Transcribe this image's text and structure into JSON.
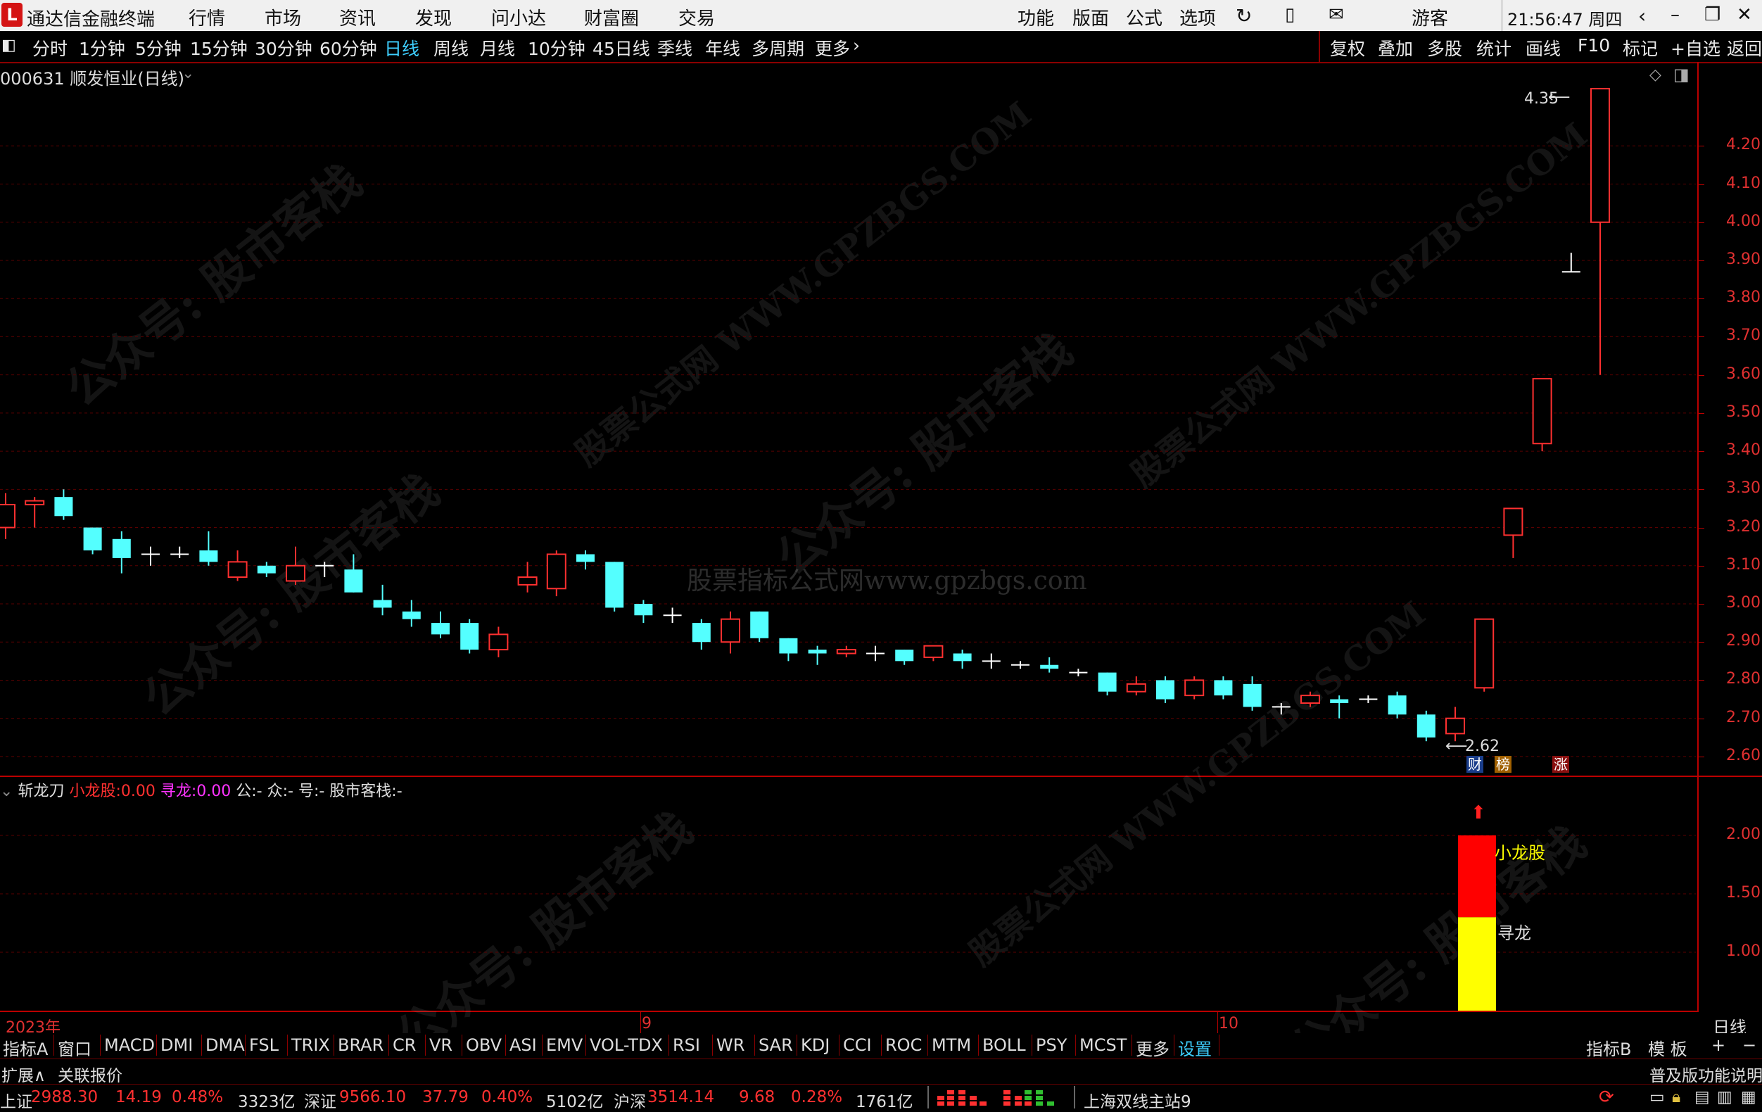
{
  "menubar": {
    "title": "通达信金融终端",
    "items": [
      "行情",
      "市场",
      "资讯",
      "发现",
      "问小达",
      "财富圈",
      "交易"
    ],
    "right_items": [
      "功能",
      "版面",
      "公式",
      "选项"
    ],
    "user": "游客",
    "clock": "21:56:47 周四"
  },
  "toolbar": {
    "periods": [
      "分时",
      "1分钟",
      "5分钟",
      "15分钟",
      "30分钟",
      "60分钟",
      "日线",
      "周线",
      "月线",
      "10分钟",
      "45日线",
      "季线",
      "年线",
      "多周期",
      "更多"
    ],
    "active": "日线",
    "right": [
      "复权",
      "叠加",
      "多股",
      "统计",
      "画线",
      "F10",
      "标记",
      "+自选",
      "返回"
    ]
  },
  "chart_header": "000631 顺发恒业(日线)",
  "indicator_header": {
    "name": "斩龙刀",
    "xiaolong_label": "小龙股:",
    "xiaolong_value": "0.00",
    "xunlong_label": "寻龙:",
    "xunlong_value": "0.00",
    "rest": "公:- 众:- 号:- 股市客栈:-"
  },
  "badges": [
    "财",
    "榜",
    "涨"
  ],
  "annotations": {
    "high": "4.35",
    "low": "2.62",
    "bar_top": "小龙股",
    "bar_low": "寻龙"
  },
  "x_axis": {
    "year": "2023年",
    "m9": "9",
    "m10": "10"
  },
  "watermarks": [
    "公众号: 股市客栈",
    "股票公式网  WWW.GPZBGS.COM",
    "股票指标公式网www.gpzbgs.com"
  ],
  "chart_data": {
    "type": "candlestick",
    "ylim": [
      2.55,
      4.42
    ],
    "yticks": [
      "4.20",
      "4.10",
      "4.00",
      "3.90",
      "3.80",
      "3.70",
      "3.60",
      "3.50",
      "3.40",
      "3.30",
      "3.20",
      "3.10",
      "3.00",
      "2.90",
      "2.80",
      "2.70",
      "2.60"
    ],
    "candles": [
      [
        3.2,
        3.26,
        3.17,
        3.29
      ],
      [
        3.26,
        3.27,
        3.2,
        3.28
      ],
      [
        3.28,
        3.23,
        3.22,
        3.3
      ],
      [
        3.2,
        3.14,
        3.13,
        3.2
      ],
      [
        3.17,
        3.12,
        3.08,
        3.19
      ],
      [
        3.13,
        3.13,
        3.1,
        3.15
      ],
      [
        3.13,
        3.13,
        3.12,
        3.15
      ],
      [
        3.14,
        3.11,
        3.1,
        3.19
      ],
      [
        3.07,
        3.11,
        3.06,
        3.14
      ],
      [
        3.1,
        3.08,
        3.07,
        3.11
      ],
      [
        3.06,
        3.1,
        3.05,
        3.15
      ],
      [
        3.1,
        3.1,
        3.07,
        3.11
      ],
      [
        3.09,
        3.03,
        3.03,
        3.13
      ],
      [
        3.01,
        2.99,
        2.97,
        3.05
      ],
      [
        2.98,
        2.96,
        2.94,
        3.01
      ],
      [
        2.95,
        2.92,
        2.91,
        2.98
      ],
      [
        2.95,
        2.88,
        2.87,
        2.96
      ],
      [
        2.88,
        2.92,
        2.86,
        2.94
      ],
      [
        3.05,
        3.07,
        3.03,
        3.11
      ],
      [
        3.04,
        3.13,
        3.02,
        3.14
      ],
      [
        3.13,
        3.11,
        3.09,
        3.14
      ],
      [
        3.11,
        2.99,
        2.98,
        3.11
      ],
      [
        3.0,
        2.97,
        2.95,
        3.01
      ],
      [
        2.97,
        2.97,
        2.95,
        2.99
      ],
      [
        2.95,
        2.9,
        2.88,
        2.96
      ],
      [
        2.9,
        2.96,
        2.87,
        2.98
      ],
      [
        2.98,
        2.91,
        2.9,
        2.98
      ],
      [
        2.91,
        2.87,
        2.85,
        2.91
      ],
      [
        2.88,
        2.87,
        2.84,
        2.89
      ],
      [
        2.87,
        2.88,
        2.86,
        2.89
      ],
      [
        2.87,
        2.87,
        2.85,
        2.89
      ],
      [
        2.88,
        2.85,
        2.84,
        2.88
      ],
      [
        2.86,
        2.89,
        2.85,
        2.89
      ],
      [
        2.87,
        2.85,
        2.83,
        2.88
      ],
      [
        2.85,
        2.85,
        2.83,
        2.87
      ],
      [
        2.84,
        2.84,
        2.83,
        2.85
      ],
      [
        2.84,
        2.83,
        2.82,
        2.86
      ],
      [
        2.82,
        2.82,
        2.81,
        2.83
      ],
      [
        2.82,
        2.77,
        2.76,
        2.82
      ],
      [
        2.77,
        2.79,
        2.76,
        2.81
      ],
      [
        2.8,
        2.75,
        2.74,
        2.81
      ],
      [
        2.76,
        2.8,
        2.75,
        2.81
      ],
      [
        2.8,
        2.76,
        2.75,
        2.81
      ],
      [
        2.79,
        2.73,
        2.72,
        2.81
      ],
      [
        2.73,
        2.73,
        2.71,
        2.74
      ],
      [
        2.74,
        2.76,
        2.73,
        2.77
      ],
      [
        2.75,
        2.74,
        2.7,
        2.76
      ],
      [
        2.75,
        2.75,
        2.74,
        2.76
      ],
      [
        2.76,
        2.71,
        2.7,
        2.77
      ],
      [
        2.71,
        2.65,
        2.64,
        2.72
      ],
      [
        2.66,
        2.7,
        2.64,
        2.73
      ],
      [
        2.78,
        2.96,
        2.77,
        2.96
      ],
      [
        3.18,
        3.25,
        3.12,
        3.25
      ],
      [
        3.42,
        3.59,
        3.4,
        3.59
      ],
      [
        3.87,
        3.87,
        3.87,
        3.92
      ],
      [
        4.0,
        4.35,
        3.6,
        4.35
      ]
    ],
    "indicator": {
      "ylim": [
        0.5,
        2.5
      ],
      "yticks": [
        "2.00",
        "1.50",
        "1.00"
      ],
      "stack": [
        {
          "name": "寻龙",
          "value": 1.3,
          "color": "#ffff00"
        },
        {
          "name": "小龙股",
          "value": 2.0,
          "color": "#ff0000"
        }
      ]
    }
  },
  "bottom_tabs": [
    "指标A",
    "窗口",
    "MACD",
    "DMI",
    "DMA",
    "FSL",
    "TRIX",
    "BRAR",
    "CR",
    "VR",
    "OBV",
    "ASI",
    "EMV",
    "VOL-TDX",
    "RSI",
    "WR",
    "SAR",
    "KDJ",
    "CCI",
    "ROC",
    "MTM",
    "BOLL",
    "PSY",
    "MCST",
    "更多",
    "设置"
  ],
  "bottom_right": [
    "指标B",
    "模 板",
    "+",
    "−"
  ],
  "period_label": "日线",
  "ext": {
    "left": "扩展∧",
    "quote": "关联报价",
    "right": "普及版功能说明"
  },
  "status": {
    "sh_label": "上证",
    "sh": "2988.30",
    "sh_chg": "14.19",
    "sh_pct": "0.48%",
    "sh_amt": "3323亿",
    "sz_label": "深证",
    "sz": "9566.10",
    "sz_chg": "37.79",
    "sz_pct": "0.40%",
    "sz_amt": "5102亿",
    "hs_label": "沪深",
    "hs": "3514.14",
    "hs_chg": "9.68",
    "hs_pct": "0.28%",
    "hs_amt": "1761亿",
    "server": "上海双线主站9"
  },
  "colors": {
    "up": "#ff3030",
    "down": "#54ffff",
    "grid": "#5a0000",
    "active": "#3ecfff"
  }
}
